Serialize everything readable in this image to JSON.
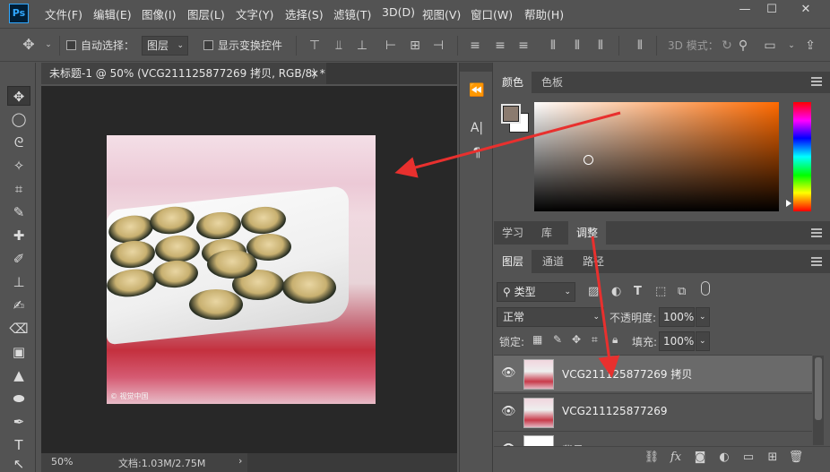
{
  "app": {
    "logo": "Ps"
  },
  "menu": [
    "文件(F)",
    "编辑(E)",
    "图像(I)",
    "图层(L)",
    "文字(Y)",
    "选择(S)",
    "滤镜(T)",
    "3D(D)",
    "视图(V)",
    "窗口(W)",
    "帮助(H)"
  ],
  "window_controls": {
    "minimize": "—",
    "maximize": "☐",
    "close": "✕"
  },
  "options_bar": {
    "auto_select_label": "自动选择：",
    "auto_select_value": "图层",
    "show_transform_label": "显示变换控件",
    "mode_3d_label": "3D 模式："
  },
  "document": {
    "tab_title": "未标题-1 @ 50% (VCG211125877269 拷贝, RGB/8) *",
    "tab_close": "×",
    "zoom": "50%",
    "doc_size": "文档:1.03M/2.75M",
    "watermark": "© 视觉中国"
  },
  "color_panel": {
    "tabs": [
      "颜色",
      "色板"
    ],
    "active_tab": 0,
    "foreground_color": "#8b7b6f",
    "background_color": "#ffffff"
  },
  "mid_panel": {
    "tabs": [
      "学习",
      "库",
      "调整"
    ],
    "active_tab": 2
  },
  "layers_panel": {
    "tabs": [
      "图层",
      "通道",
      "路径"
    ],
    "active_tab": 0,
    "filter_label": "类型",
    "blend_mode": "正常",
    "opacity_label": "不透明度:",
    "opacity_value": "100%",
    "lock_label": "锁定:",
    "fill_label": "填充:",
    "fill_value": "100%",
    "layers": [
      {
        "name": "VCG211125877269 拷贝",
        "selected": true
      },
      {
        "name": "VCG211125877269",
        "selected": false
      },
      {
        "name": "背景",
        "selected": false
      }
    ]
  },
  "colors": {
    "arrow": "#e8302e",
    "accent": "#31a8ff"
  }
}
